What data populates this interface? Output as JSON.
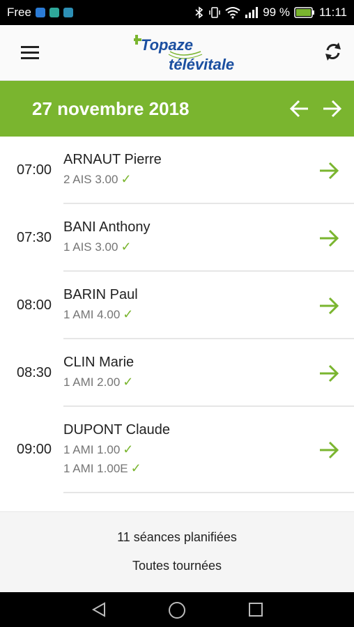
{
  "status_bar": {
    "carrier": "Free",
    "battery_percent": "99 %",
    "time": "11:11",
    "icons": [
      "bluetooth-icon",
      "vibrate-icon",
      "wifi-icon",
      "signal-icon",
      "battery-icon"
    ]
  },
  "app_bar": {
    "logo_top": "Topaze",
    "logo_bottom": "télévitale",
    "menu_icon": "hamburger-menu-icon",
    "sync_icon": "sync-icon"
  },
  "date_bar": {
    "date": "27 novembre 2018",
    "prev_icon": "arrow-left-icon",
    "next_icon": "arrow-right-icon"
  },
  "appointments": [
    {
      "time": "07:00",
      "patient": "ARNAUT Pierre",
      "acts": [
        "2 AIS 3.00"
      ]
    },
    {
      "time": "07:30",
      "patient": "BANI Anthony",
      "acts": [
        "1 AIS 3.00"
      ]
    },
    {
      "time": "08:00",
      "patient": "BARIN Paul",
      "acts": [
        "1 AMI 4.00"
      ]
    },
    {
      "time": "08:30",
      "patient": "CLIN Marie",
      "acts": [
        "1 AMI 2.00"
      ]
    },
    {
      "time": "09:00",
      "patient": "DUPONT Claude",
      "acts": [
        "1 AMI 1.00",
        "1 AMI 1.00E"
      ]
    }
  ],
  "footer": {
    "sessions_count": "11 séances planifiées",
    "tours_label": "Toutes tournées"
  },
  "colors": {
    "accent_green": "#7ab52f",
    "logo_blue": "#1b4fa0"
  }
}
